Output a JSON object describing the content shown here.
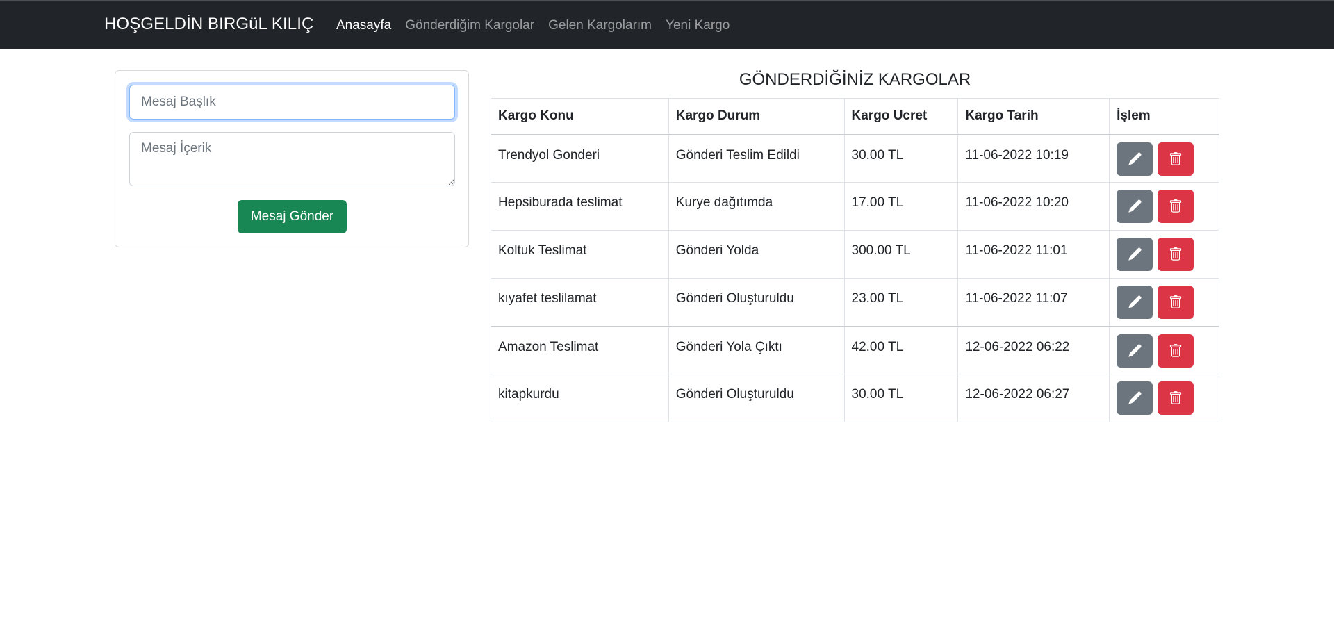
{
  "navbar": {
    "brand": "HOŞGELDİN BIRGüL KILIÇ",
    "links": [
      {
        "label": "Anasayfa",
        "active": true
      },
      {
        "label": "Gönderdiğim Kargolar",
        "active": false
      },
      {
        "label": "Gelen Kargolarım",
        "active": false
      },
      {
        "label": "Yeni Kargo",
        "active": false
      }
    ]
  },
  "message_form": {
    "title_placeholder": "Mesaj Başlık",
    "title_value": "",
    "body_placeholder": "Mesaj İçerik",
    "body_value": "",
    "send_label": "Mesaj Gönder"
  },
  "cargo_table": {
    "title": "GÖNDERDİĞİNİZ KARGOLAR",
    "headers": [
      "Kargo Konu",
      "Kargo Durum",
      "Kargo Ucret",
      "Kargo Tarih",
      "İşlem"
    ],
    "rows": [
      {
        "konu": "Trendyol Gonderi",
        "durum": "Gönderi Teslim Edildi",
        "ucret": "30.00 TL",
        "tarih": "11-06-2022 10:19"
      },
      {
        "konu": "Hepsiburada teslimat",
        "durum": "Kurye dağıtımda",
        "ucret": "17.00 TL",
        "tarih": "11-06-2022 10:20"
      },
      {
        "konu": "Koltuk Teslimat",
        "durum": "Gönderi Yolda",
        "ucret": "300.00 TL",
        "tarih": "11-06-2022 11:01"
      },
      {
        "konu": "kıyafet teslilamat",
        "durum": "Gönderi Oluşturuldu",
        "ucret": "23.00 TL",
        "tarih": "11-06-2022 11:07"
      },
      {
        "konu": "Amazon Teslimat",
        "durum": "Gönderi Yola Çıktı",
        "ucret": "42.00 TL",
        "tarih": "12-06-2022 06:22"
      },
      {
        "konu": "kitapkurdu",
        "durum": "Gönderi Oluşturuldu",
        "ucret": "30.00 TL",
        "tarih": "12-06-2022 06:27"
      }
    ],
    "actions": {
      "edit_icon": "pencil-icon",
      "delete_icon": "trash-icon"
    }
  },
  "colors": {
    "navbar_bg": "#212529",
    "success": "#198754",
    "secondary": "#6c757d",
    "danger": "#dc3545",
    "focus_border": "#86b7fe"
  }
}
